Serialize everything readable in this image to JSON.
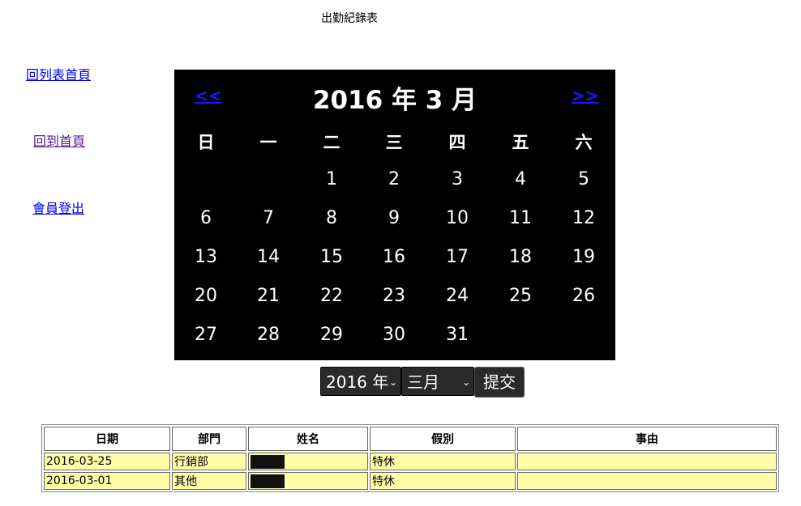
{
  "page_title": "出勤紀錄表",
  "sidebar": {
    "list_link": "回列表首頁",
    "home_link": "回到首頁",
    "logout_link": "會員登出"
  },
  "calendar": {
    "prev": "<<",
    "next": ">>",
    "title": "2016 年 3 月",
    "weekdays": [
      "日",
      "一",
      "二",
      "三",
      "四",
      "五",
      "六"
    ],
    "weeks": [
      [
        "",
        "",
        "1",
        "2",
        "3",
        "4",
        "5"
      ],
      [
        "6",
        "7",
        "8",
        "9",
        "10",
        "11",
        "12"
      ],
      [
        "13",
        "14",
        "15",
        "16",
        "17",
        "18",
        "19"
      ],
      [
        "20",
        "21",
        "22",
        "23",
        "24",
        "25",
        "26"
      ],
      [
        "27",
        "28",
        "29",
        "30",
        "31",
        "",
        ""
      ]
    ]
  },
  "controls": {
    "year_selected": "2016 年",
    "month_selected": "三月",
    "submit_label": "提交"
  },
  "table": {
    "headers": [
      "日期",
      "部門",
      "姓名",
      "假別",
      "事由"
    ],
    "rows": [
      {
        "date": "2016-03-25",
        "dept": "行銷部",
        "leave": "特休",
        "reason": ""
      },
      {
        "date": "2016-03-01",
        "dept": "其他",
        "leave": "特休",
        "reason": ""
      }
    ]
  },
  "colors": {
    "calendar_bg": "#000000",
    "row_bg": "#ffffaa",
    "link": "#0000ee",
    "visited_link": "#551a8b"
  }
}
